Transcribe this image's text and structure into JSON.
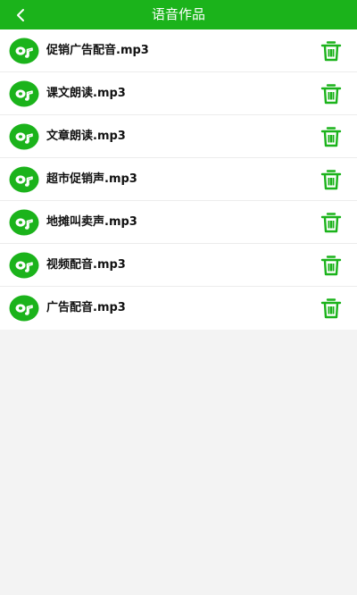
{
  "header": {
    "title": "语音作品",
    "back_icon": "chevron-left-icon",
    "background_color": "#1bb31b"
  },
  "files": [
    {
      "name": "促销广告配音.mp3"
    },
    {
      "name": "课文朗读.mp3"
    },
    {
      "name": "文章朗读.mp3"
    },
    {
      "name": "超市促销声.mp3"
    },
    {
      "name": "地摊叫卖声.mp3"
    },
    {
      "name": "视频配音.mp3"
    },
    {
      "name": "广告配音.mp3"
    }
  ],
  "icons": {
    "file_icon": "music-disc-icon",
    "delete_icon": "trash-icon"
  },
  "colors": {
    "accent": "#1bb31b",
    "page_background": "#f3f3f3"
  }
}
